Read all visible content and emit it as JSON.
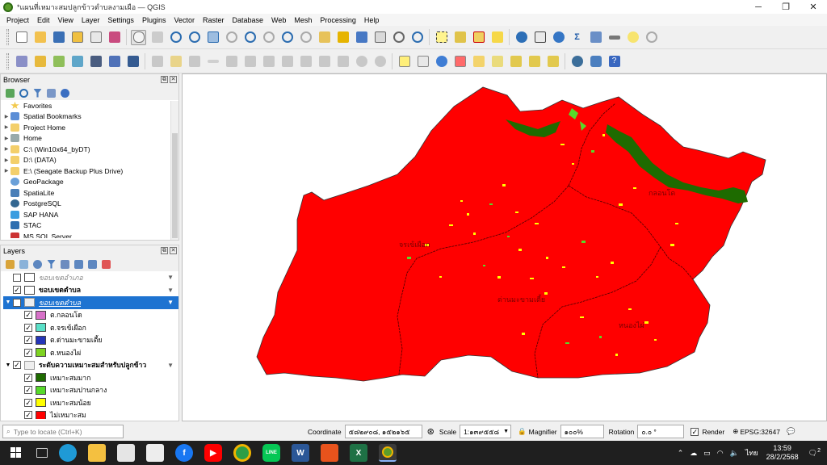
{
  "window": {
    "title": "*แผนที่เหมาะสมปลูกข้าวตำบลงามเผือ — QGIS",
    "minimize_glyph": "─",
    "maximize_glyph": "❐",
    "close_glyph": "✕"
  },
  "menu": [
    "Project",
    "Edit",
    "View",
    "Layer",
    "Settings",
    "Plugins",
    "Vector",
    "Raster",
    "Database",
    "Web",
    "Mesh",
    "Processing",
    "Help"
  ],
  "browser": {
    "title": "Browser",
    "items": [
      {
        "label": "Favorites",
        "icon": "star-icon",
        "expandable": false
      },
      {
        "label": "Spatial Bookmarks",
        "icon": "bookmark-icon",
        "expandable": true
      },
      {
        "label": "Project Home",
        "icon": "folder-icon",
        "expandable": true
      },
      {
        "label": "Home",
        "icon": "home-icon",
        "expandable": true
      },
      {
        "label": "C:\\ (Win10x64_byDT)",
        "icon": "folder-icon",
        "expandable": true
      },
      {
        "label": "D:\\ (DATA)",
        "icon": "folder-icon",
        "expandable": true
      },
      {
        "label": "E:\\ (Seagate Backup Plus Drive)",
        "icon": "folder-icon",
        "expandable": true
      },
      {
        "label": "GeoPackage",
        "icon": "geopackage-icon",
        "expandable": false
      },
      {
        "label": "SpatiaLite",
        "icon": "spatialite-icon",
        "expandable": false
      },
      {
        "label": "PostgreSQL",
        "icon": "postgresql-icon",
        "expandable": false
      },
      {
        "label": "SAP HANA",
        "icon": "saphana-icon",
        "expandable": false
      },
      {
        "label": "STAC",
        "icon": "stac-icon",
        "expandable": false
      },
      {
        "label": "MS SQL Server",
        "icon": "mssql-icon",
        "expandable": false
      }
    ]
  },
  "layers": {
    "title": "Layers",
    "rows": [
      {
        "label": "ขอบเขตอำเภอ",
        "checked": false,
        "style": "italic",
        "indent": 0,
        "swatch": "#ffffff"
      },
      {
        "label": "ขอบเขตตำบล",
        "checked": true,
        "style": "bold",
        "indent": 0,
        "swatch": "#ffffff"
      },
      {
        "label": "ขอบเขตตำบล",
        "checked": false,
        "style": "selected",
        "indent": 0,
        "swatch": ""
      },
      {
        "label": "ต.กลอนโด",
        "checked": true,
        "style": "normal",
        "indent": 1,
        "swatch": "#d771c8"
      },
      {
        "label": "ต.จรเข้เผือก",
        "checked": true,
        "style": "normal",
        "indent": 1,
        "swatch": "#59e0c8"
      },
      {
        "label": "ต.ด่านมะขามเตี้ย",
        "checked": true,
        "style": "normal",
        "indent": 1,
        "swatch": "#2536b8"
      },
      {
        "label": "ต.หนองไผ่",
        "checked": true,
        "style": "normal",
        "indent": 1,
        "swatch": "#7ed321"
      },
      {
        "label": "ระดับความเหมาะสมสำหรับปลูกข้าว",
        "checked": true,
        "style": "bold",
        "indent": 0,
        "swatch": ""
      },
      {
        "label": "เหมาะสมมาก",
        "checked": true,
        "style": "normal",
        "indent": 1,
        "swatch": "#1e6b00"
      },
      {
        "label": "เหมาะสมปานกลาง",
        "checked": true,
        "style": "normal",
        "indent": 1,
        "swatch": "#57d92a"
      },
      {
        "label": "เหมาะสมน้อย",
        "checked": true,
        "style": "normal",
        "indent": 1,
        "swatch": "#ffff00"
      },
      {
        "label": "ไม่เหมาะสม",
        "checked": true,
        "style": "normal",
        "indent": 1,
        "swatch": "#ff0000"
      }
    ]
  },
  "map": {
    "labels": [
      "กลอนโด",
      "จรเข้เผือก",
      "ด่านมะขามเตี้ย",
      "หนองไผ่"
    ],
    "colors": {
      "unsuitable": "#ff0000",
      "very_suitable": "#1e6b00",
      "medium": "#57d92a",
      "low": "#ffff00"
    }
  },
  "status": {
    "locate_placeholder": "Type to locate (Ctrl+K)",
    "coordinate_label": "Coordinate",
    "coordinate_value": "๕๘๒๙๐๘, ๑๕๒๑๖๕",
    "scale_label": "Scale",
    "scale_value": "1:๑๓๙๕๕๘",
    "magnifier_label": "Magnifier",
    "magnifier_value": "๑๐๐%",
    "rotation_label": "Rotation",
    "rotation_value": "๐.๐ °",
    "render_label": "Render",
    "render_checked": true,
    "crs": "EPSG:32647"
  },
  "taskbar": {
    "time": "13:59",
    "date": "28/2/2568",
    "lang": "ไทย",
    "notif_count": "2"
  }
}
